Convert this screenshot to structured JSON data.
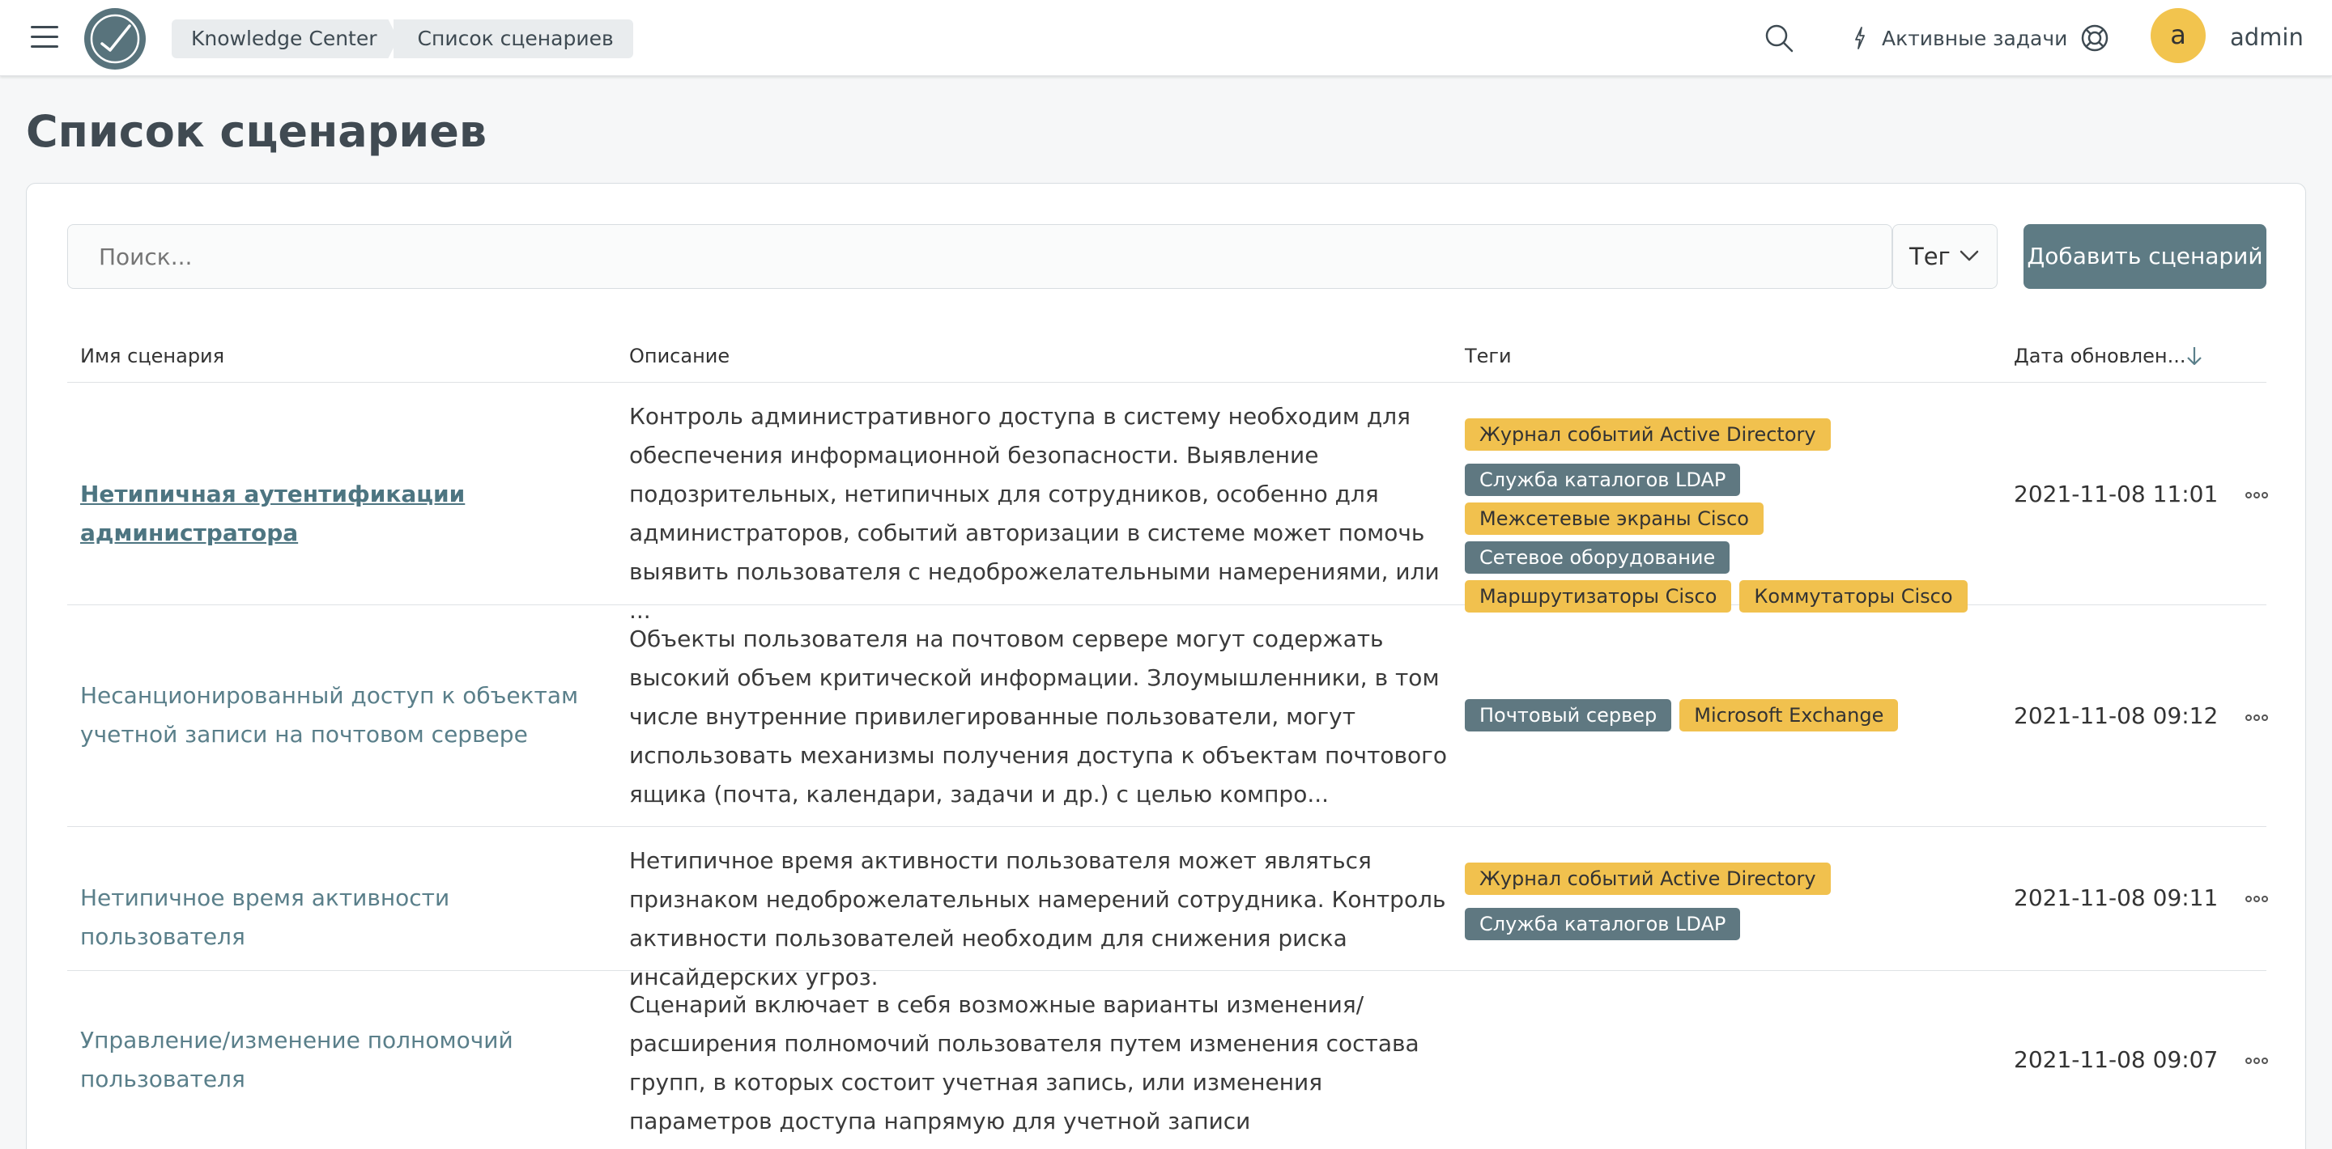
{
  "header": {
    "breadcrumbs": [
      "Knowledge Center",
      "Список сценариев"
    ],
    "active_tasks_label": "Активные задачи",
    "avatar_letter": "a",
    "username": "admin"
  },
  "page": {
    "title": "Список сценариев"
  },
  "toolbar": {
    "search_placeholder": "Поиск...",
    "tag_filter_label": "Тег",
    "add_button_label": "Добавить сценарий"
  },
  "table": {
    "columns": {
      "name": "Имя сценария",
      "description": "Описание",
      "tags": "Теги",
      "updated": "Дата обновлен..."
    },
    "rows": [
      {
        "name": "Нетипичная аутентификации администратора",
        "description": "Контроль административного доступа в систему необходим для обеспечения информационной безопасности. Выявление подозрительных, нетипичных для сотрудников, особенно для администраторов, событий авторизации в системе может помочь выявить пользователя с недоброжелательными намерениями, или ...",
        "tags": [
          {
            "label": "Журнал событий Active Directory",
            "color": "#f1c14e"
          },
          {
            "label": "Служба каталогов LDAP",
            "color": "#5f7881"
          },
          {
            "label": "Межсетевые экраны Cisco",
            "color": "#f1c14e"
          },
          {
            "label": "Сетевое оборудование",
            "color": "#5f7881"
          },
          {
            "label": "Маршрутизаторы Cisco",
            "color": "#f1c14e"
          },
          {
            "label": "Коммутаторы Cisco",
            "color": "#f1c14e"
          }
        ],
        "updated": "2021-11-08 11:01"
      },
      {
        "name": "Несанционированный доступ к объектам учетной записи на почтовом сервере",
        "description": "Объекты пользователя на почтовом сервере могут содержать высокий объем критической информации. Злоумышленники, в том числе внутренние привилегированные пользователи, могут использовать механизмы получения доступа к объектам почтового ящика (почта, календари, задачи и др.) с целью компро...",
        "tags": [
          {
            "label": "Почтовый сервер",
            "color": "#5f7881"
          },
          {
            "label": "Microsoft Exchange",
            "color": "#f1c14e"
          }
        ],
        "updated": "2021-11-08 09:12"
      },
      {
        "name": "Нетипичное время активности пользователя",
        "description": "Нетипичное время активности пользователя может являться признаком недоброжелательных намерений сотрудника. Контроль активности пользователей необходим для снижения риска инсайдерских угроз.",
        "tags": [
          {
            "label": "Журнал событий Active Directory",
            "color": "#f1c14e"
          },
          {
            "label": "Служба каталогов LDAP",
            "color": "#5f7881"
          }
        ],
        "updated": "2021-11-08 09:11"
      },
      {
        "name": "Управление/изменение полномочий пользователя",
        "description": "Сценарий включает в себя возможные варианты изменения/расширения полномочий пользователя путем изменения состава групп, в которых состоит учетная запись, или изменения параметров доступа напрямую для учетной записи",
        "tags": [],
        "updated": "2021-11-08 09:07"
      }
    ]
  }
}
